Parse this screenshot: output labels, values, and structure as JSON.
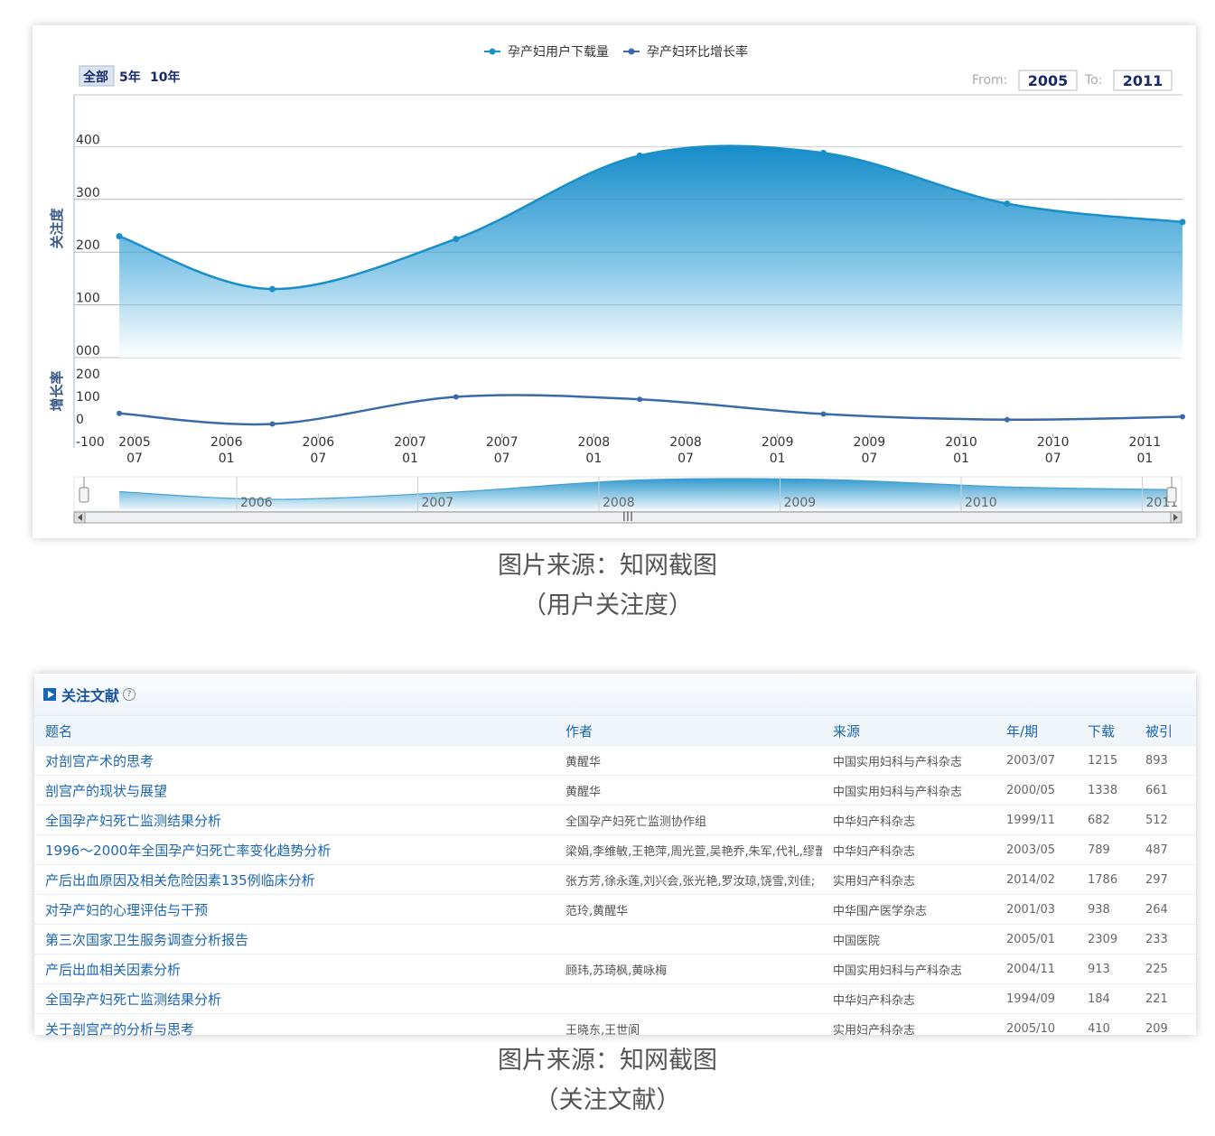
{
  "chart_panel": {
    "legend": [
      "孕产妇用户下载量",
      "孕产妇环比增长率"
    ],
    "range_buttons": [
      "全部",
      "5年",
      "10年"
    ],
    "from_label": "From:",
    "from_value": "2005",
    "to_label": "To:",
    "to_value": "2011",
    "nav_labels": [
      "2006",
      "2007",
      "2008",
      "2009",
      "2010",
      "2011"
    ],
    "nav_scroll_grip": "III",
    "colors": {
      "upper_line": "#1a8fc8",
      "lower_line": "#3a6aa8",
      "fill_top": "#0a86c6"
    }
  },
  "chart_data": {
    "type": "area",
    "x_ticks": [
      [
        "2005",
        "07"
      ],
      [
        "2006",
        "01"
      ],
      [
        "2006",
        "07"
      ],
      [
        "2007",
        "01"
      ],
      [
        "2007",
        "07"
      ],
      [
        "2008",
        "01"
      ],
      [
        "2008",
        "07"
      ],
      [
        "2009",
        "01"
      ],
      [
        "2009",
        "07"
      ],
      [
        "2010",
        "01"
      ],
      [
        "2010",
        "07"
      ],
      [
        "2011",
        "01"
      ]
    ],
    "panes": [
      {
        "ylabel": "关注度",
        "y_ticks": [
          "400",
          "300",
          "200",
          "100",
          "000"
        ],
        "ylim": [
          0,
          500
        ],
        "series": [
          {
            "name": "孕产妇用户下载量",
            "type": "area",
            "x": [
              "2005-06",
              "2006-04",
              "2007-04",
              "2008-04",
              "2009-04",
              "2010-04",
              "2011-04"
            ],
            "values": [
              230,
              130,
              225,
              383,
              388,
              292,
              257
            ]
          }
        ]
      },
      {
        "ylabel": "增长率",
        "y_ticks": [
          "200",
          "100",
          "0",
          "-100"
        ],
        "ylim": [
          -100,
          200
        ],
        "series": [
          {
            "name": "孕产妇环比增长率",
            "type": "line",
            "x": [
              "2005-06",
              "2006-04",
              "2007-04",
              "2008-04",
              "2009-04",
              "2010-04",
              "2011-04"
            ],
            "values": [
              25,
              -22,
              98,
              87,
              22,
              -3,
              10
            ]
          }
        ]
      }
    ]
  },
  "captions": {
    "chart_source": "图片来源：知网截图",
    "chart_note": "（用户关注度）",
    "table_source": "图片来源：知网截图",
    "table_note": "（关注文献）"
  },
  "literature": {
    "title": "关注文献",
    "help": "?",
    "columns": [
      "题名",
      "作者",
      "来源",
      "年/期",
      "下载",
      "被引"
    ],
    "rows": [
      [
        "对剖宫产术的思考",
        "黄醒华",
        "中国实用妇科与产科杂志",
        "2003/07",
        "1215",
        "893"
      ],
      [
        "剖宫产的现状与展望",
        "黄醒华",
        "中国实用妇科与产科杂志",
        "2000/05",
        "1338",
        "661"
      ],
      [
        "全国孕产妇死亡监测结果分析",
        "全国孕产妇死亡监测协作组",
        "中华妇产科杂志",
        "1999/11",
        "682",
        "512"
      ],
      [
        "1996～2000年全国孕产妇死亡率变化趋势分析",
        "梁娟,李维敏,王艳萍,周光萱,吴艳乔,朱军,代礼,缪蕾",
        "中华妇产科杂志",
        "2003/05",
        "789",
        "487"
      ],
      [
        "产后出血原因及相关危险因素135例临床分析",
        "张方芳,徐永莲,刘兴会,张光艳,罗汝琼,饶雪,刘佳;",
        "实用妇产科杂志",
        "2014/02",
        "1786",
        "297"
      ],
      [
        "对孕产妇的心理评估与干预",
        "范玲,黄醒华",
        "中华围产医学杂志",
        "2001/03",
        "938",
        "264"
      ],
      [
        "第三次国家卫生服务调查分析报告",
        "",
        "中国医院",
        "2005/01",
        "2309",
        "233"
      ],
      [
        "产后出血相关因素分析",
        "顾玮,苏琦枫,黄咏梅",
        "中国实用妇科与产科杂志",
        "2004/11",
        "913",
        "225"
      ],
      [
        "全国孕产妇死亡监测结果分析",
        "",
        "中华妇产科杂志",
        "1994/09",
        "184",
        "221"
      ],
      [
        "关于剖宫产的分析与思考",
        "王晓东,王世阆",
        "实用妇产科杂志",
        "2005/10",
        "410",
        "209"
      ]
    ]
  }
}
